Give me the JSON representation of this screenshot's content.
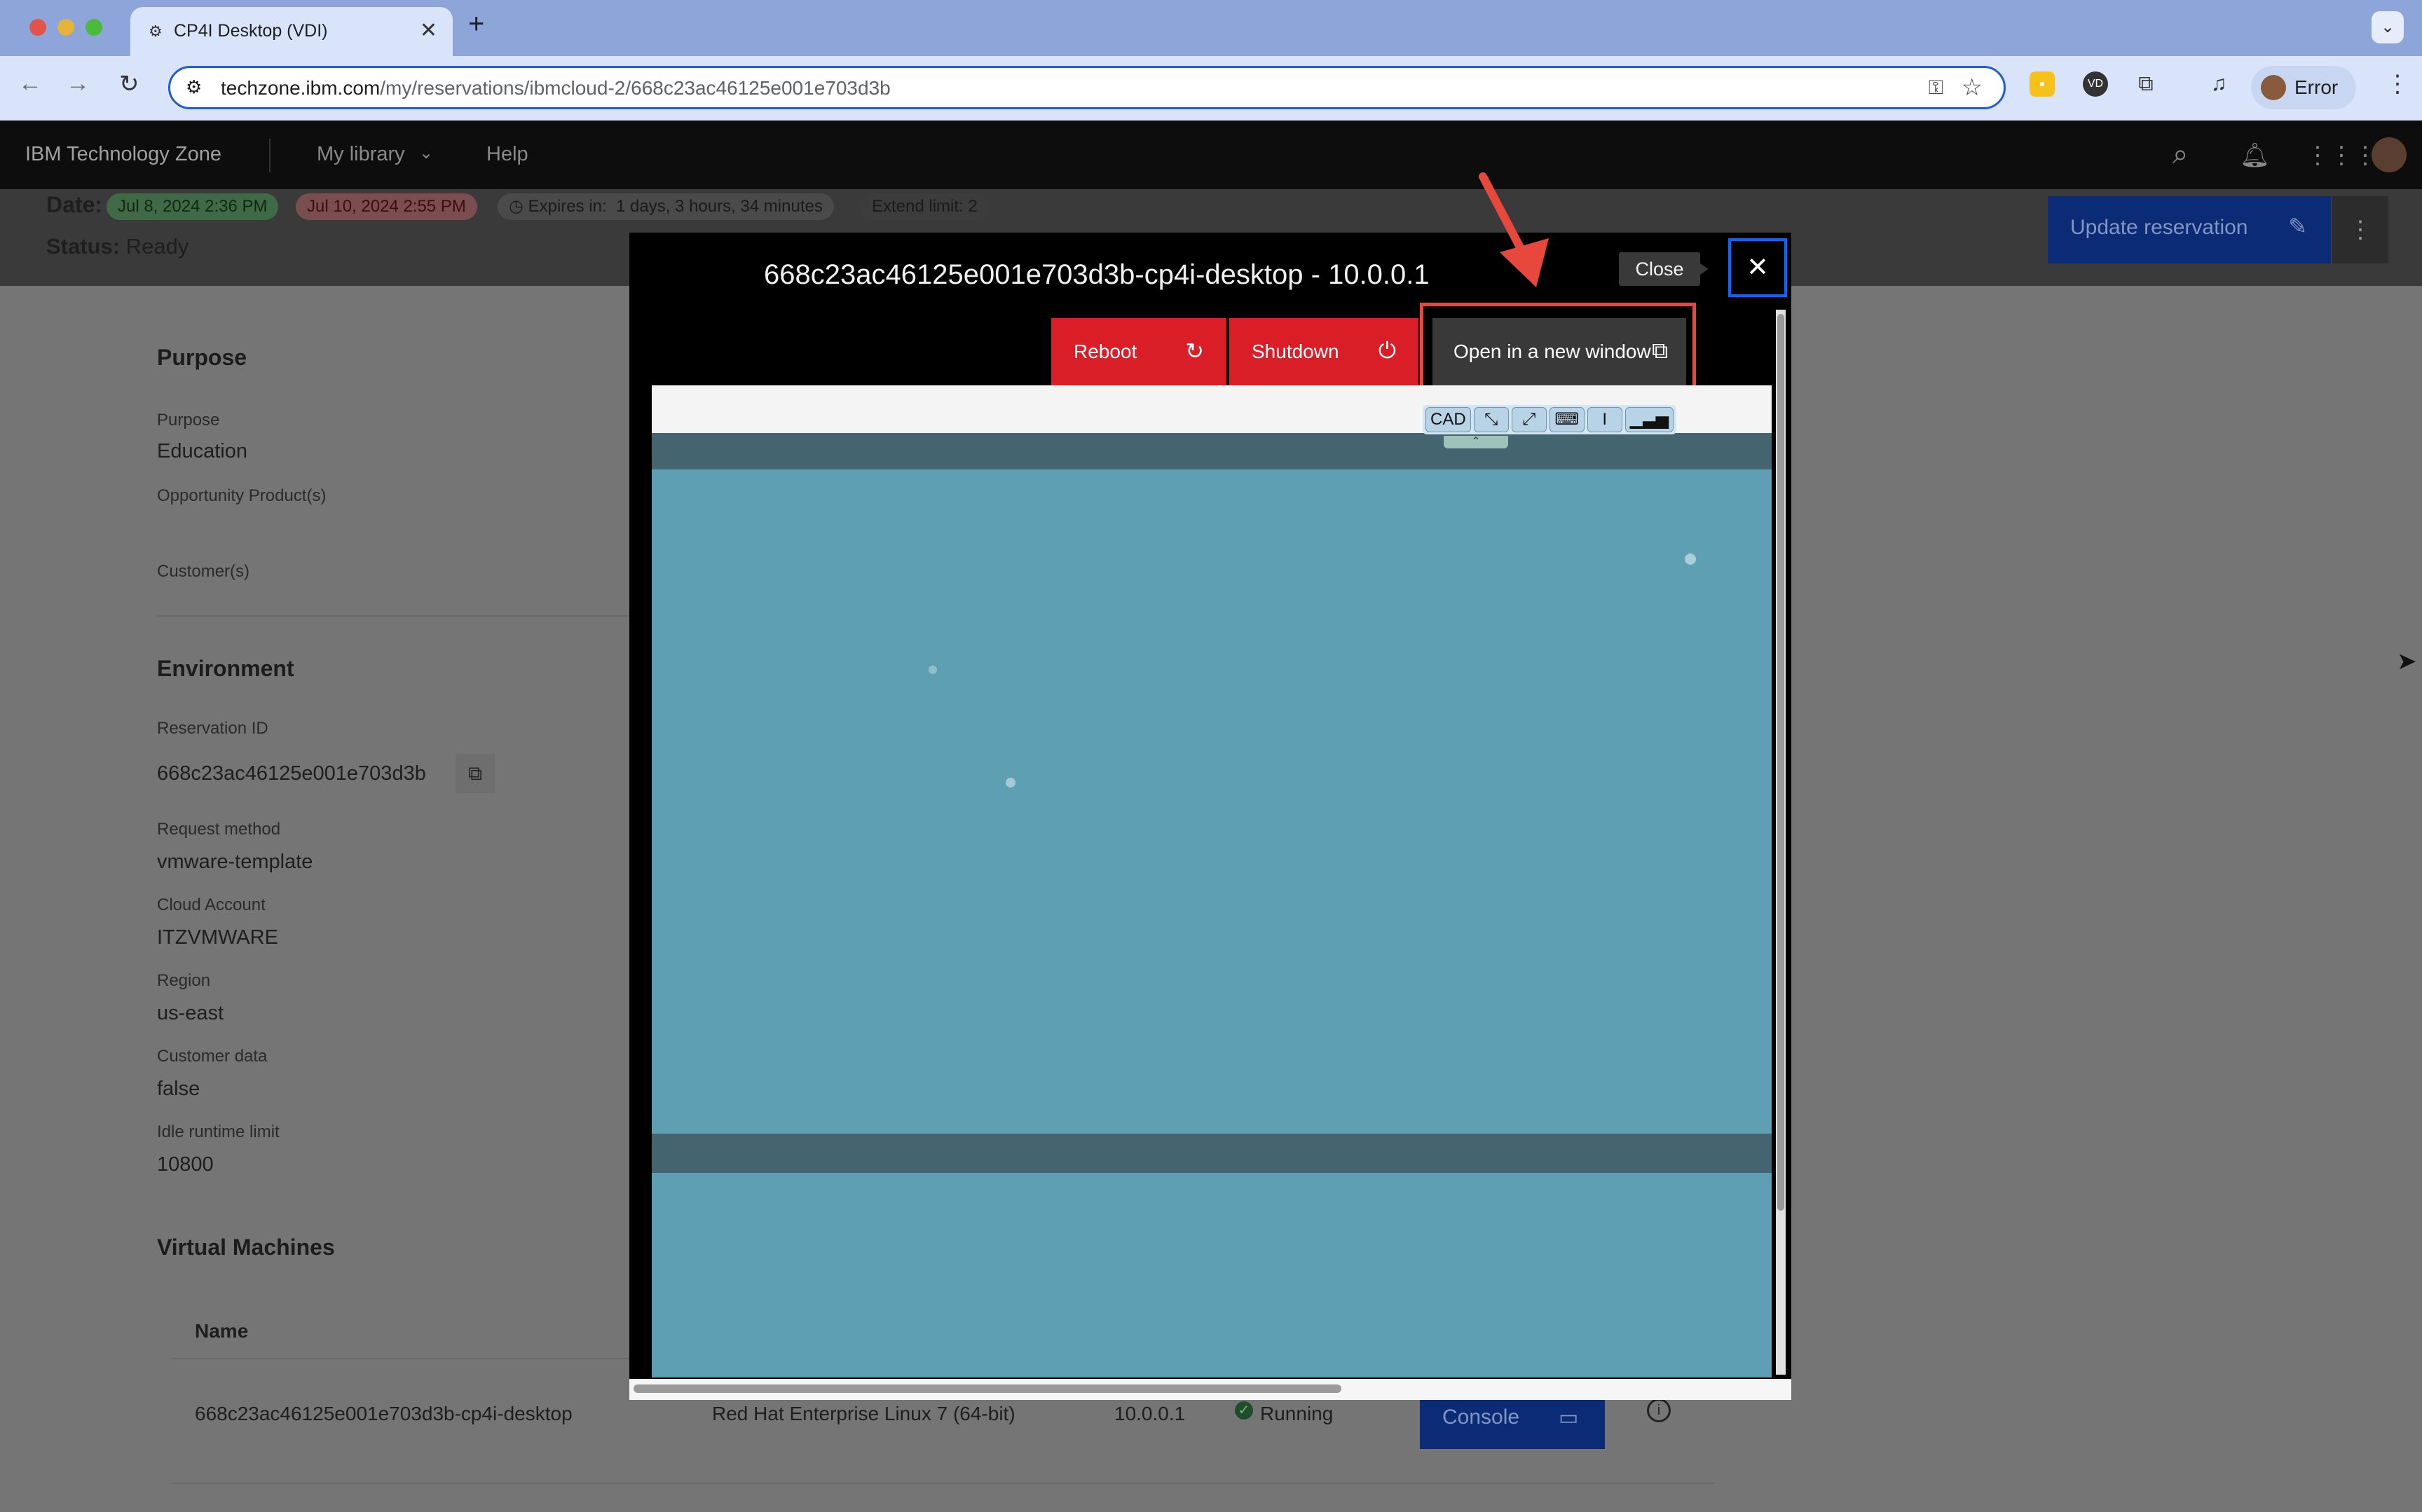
{
  "browser": {
    "tab_title": "CP4I Desktop (VDI)",
    "url_domain": "techzone.ibm.com",
    "url_path": "/my/reservations/ibmcloud-2/668c23ac46125e001e703d3b",
    "profile_label": "Error"
  },
  "app_header": {
    "brand": "IBM Technology Zone",
    "nav": [
      "My library",
      "Help"
    ]
  },
  "banner": {
    "date_label": "Date:",
    "start_date": "Jul 8, 2024 2:36 PM",
    "end_date": "Jul 10, 2024 2:55 PM",
    "expires_label": "Expires in:",
    "expires_value": "1 days, 3 hours, 34 minutes",
    "extend_limit": "Extend limit: 2",
    "status_label": "Status:",
    "status_value": "Ready",
    "update_button": "Update reservation"
  },
  "purpose": {
    "heading": "Purpose",
    "purpose_label": "Purpose",
    "purpose_value": "Education",
    "opportunity_label": "Opportunity Product(s)",
    "customers_label": "Customer(s)"
  },
  "environment": {
    "heading": "Environment",
    "fields": [
      {
        "label": "Reservation ID",
        "value": "668c23ac46125e001e703d3b"
      },
      {
        "label": "Request method",
        "value": "vmware-template"
      },
      {
        "label": "Cloud Account",
        "value": "ITZVMWARE"
      },
      {
        "label": "Region",
        "value": "us-east"
      },
      {
        "label": "Customer data",
        "value": "false"
      },
      {
        "label": "Idle runtime limit",
        "value": "10800"
      }
    ]
  },
  "vms": {
    "heading": "Virtual Machines",
    "col_name": "Name",
    "row": {
      "name": "668c23ac46125e001e703d3b-cp4i-desktop",
      "os": "Red Hat Enterprise Linux 7 (64-bit)",
      "ip": "10.0.0.1",
      "status": "Running",
      "console_button": "Console"
    }
  },
  "modal": {
    "title": "668c23ac46125e001e703d3b-cp4i-desktop - 10.0.0.1",
    "close_tooltip": "Close",
    "reboot": "Reboot",
    "shutdown": "Shutdown",
    "open_new_window": "Open in a new window",
    "vnc_toolbar": [
      "CAD"
    ]
  },
  "colors": {
    "danger": "#da1e28",
    "annotation": "#e8473b",
    "focus": "#0f62fe",
    "vnc_desktop": "#5f9fb4"
  }
}
